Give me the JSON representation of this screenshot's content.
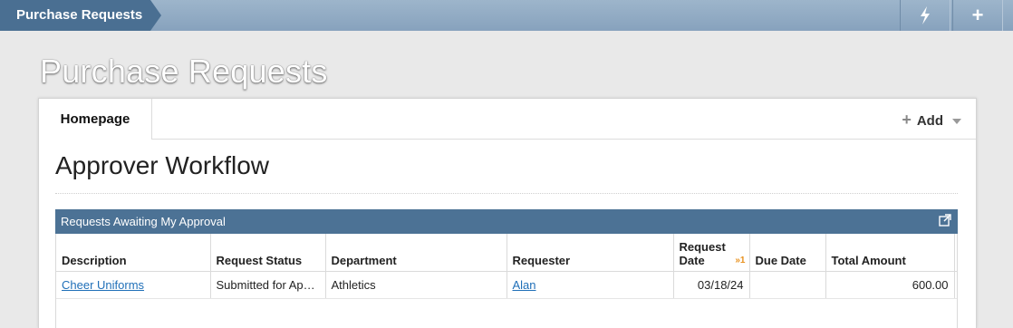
{
  "topbar": {
    "breadcrumb": "Purchase Requests",
    "buttons": [
      {
        "icon": "lightning-icon"
      },
      {
        "icon": "plus-icon",
        "glyph": "+"
      }
    ]
  },
  "page_title": "Purchase Requests",
  "tabs": {
    "home_label": "Homepage",
    "add_label": "Add",
    "add_glyph": "+"
  },
  "section_title": "Approver Workflow",
  "widget": {
    "title": "Requests Awaiting My Approval",
    "columns": {
      "description": "Description",
      "status": "Request Status",
      "department": "Department",
      "requester": "Requester",
      "request_date_1": "Request",
      "request_date_2": "Date",
      "sort_indicator": "»1",
      "due_date": "Due Date",
      "total_amount": "Total Amount"
    },
    "rows": [
      {
        "description": "Cheer Uniforms",
        "status": "Submitted for Ap…",
        "department": "Athletics",
        "requester": "Alan",
        "request_date": "03/18/24",
        "due_date": "",
        "total_amount": "600.00"
      }
    ]
  },
  "colors": {
    "topbar": "#8fa9c2",
    "breadcrumb": "#4a6f92",
    "widget_header": "#4c7295",
    "link": "#1f6fb8",
    "sort_accent": "#e8911d"
  }
}
